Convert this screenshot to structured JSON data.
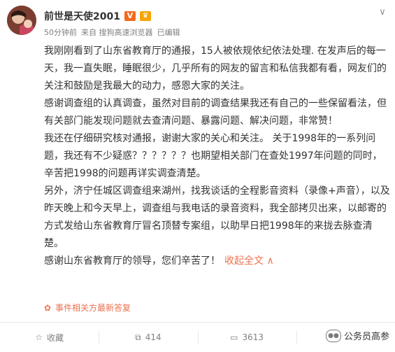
{
  "post": {
    "username": "前世是天使2001",
    "vip_badge": "V",
    "crown_badge": "♛",
    "meta": {
      "time": "50分钟前",
      "source": "来自 搜狗高速浏览器",
      "edited": "已编辑"
    },
    "paragraphs": [
      "我刚刚看到了山东省教育厅的通报，15人被依规依纪依法处理. 在发声后的每一天，我一直失眠，睡眠很少，几乎所有的网友的留言和私信我都有看，网友们的关注和鼓励是我最大的动力，感恩大家的关注。",
      "感谢调查组的认真调查，虽然对目前的调查结果我还有自己的一些保留看法，但有关部门能发现问题就去查清问题、暴露问题、解决问题，非常赞！",
      "我还在仔细研究核对通报，谢谢大家的关心和关注。 关于1998年的一系列问题，我还有不少疑惑？？？？？？也期望相关部门在查处1997年问题的同时，辛苦把1998的问题再详实调查清楚。",
      "另外，济宁任城区调查组来湖州，找我谈话的全程影音资料（录像+声音），以及昨天晚上和今天早上，调查组与我电话的录音资料，我全部拷贝出来，以邮寄的方式发给山东省教育厅冒名顶替专案组，以助早日把1998年的来拢去脉查清楚。",
      "感谢山东省教育厅的领导，您们辛苦了！"
    ],
    "expand_label": "收起全文 ∧",
    "hot_label": "事件相关方最新答复"
  },
  "toolbar": {
    "favorite": "收藏",
    "repost_count": "414",
    "comment_count": "3613"
  },
  "watermark": {
    "text": "公务员高参"
  },
  "colors": {
    "accent": "#eb7350",
    "text": "#333333",
    "muted": "#808080"
  }
}
